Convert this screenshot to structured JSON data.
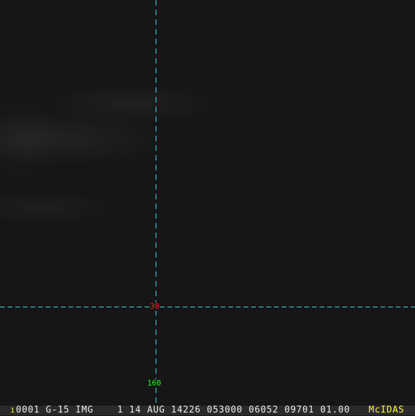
{
  "colors": {
    "grid": "#33e0e8",
    "lat_label": "#ff2020",
    "lon_label": "#20ff20",
    "brand": "#ffff30"
  },
  "grid_labels": {
    "latitude": "30",
    "longitude": "160"
  },
  "status_bar": {
    "frame_number": "1",
    "info": "0001 G-15 IMG    1 14 AUG 14226 053000 06052 09701 01.00",
    "brand": "McIDAS"
  }
}
